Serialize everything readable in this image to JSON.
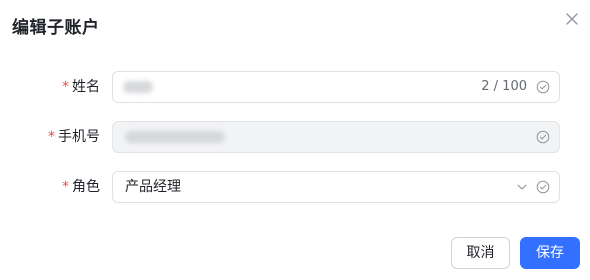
{
  "dialog": {
    "title": "编辑子账户",
    "close_icon": "close-icon"
  },
  "form": {
    "required_mark": "*",
    "name": {
      "label": "姓名",
      "value": "",
      "counter": "2 / 100",
      "status_icon": "check-circle-icon"
    },
    "phone": {
      "label": "手机号",
      "value": "",
      "status_icon": "check-circle-icon"
    },
    "role": {
      "label": "角色",
      "value": "产品经理",
      "dropdown_icon": "chevron-down-icon",
      "status_icon": "check-circle-icon"
    }
  },
  "footer": {
    "cancel_label": "取消",
    "save_label": "保存"
  },
  "colors": {
    "primary": "#3370ff",
    "required": "#f54a45",
    "border": "#dee0e3",
    "disabled_bg": "#f2f3f5"
  }
}
